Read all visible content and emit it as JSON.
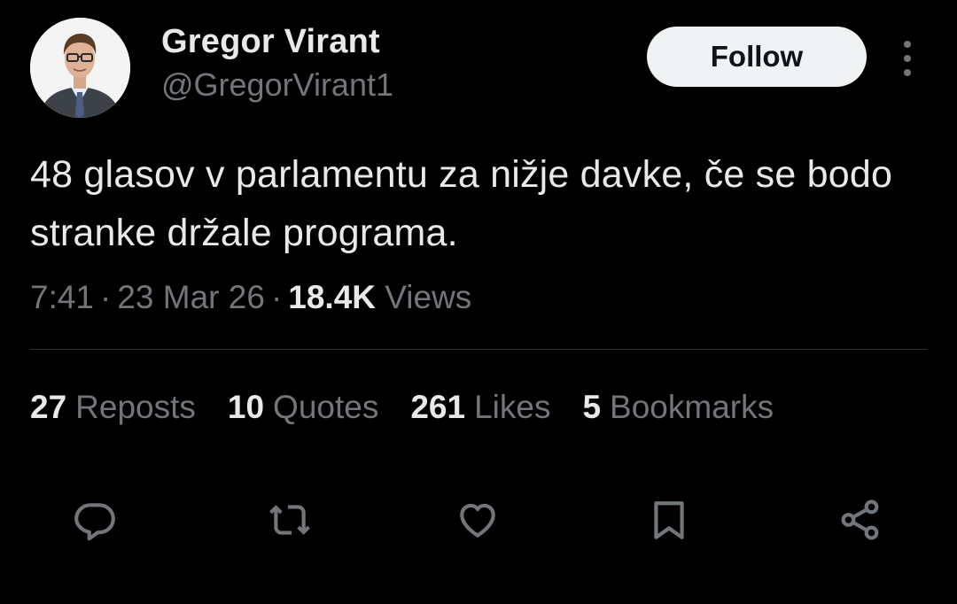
{
  "author": {
    "display_name": "Gregor Virant",
    "handle": "@GregorVirant1"
  },
  "follow_label": "Follow",
  "tweet": {
    "text": "48 glasov v parlamentu za nižje davke, če se bodo stranke držale programa."
  },
  "meta": {
    "time": "7:41",
    "separator": "·",
    "date": "23 Mar 26",
    "views_count": "18.4K",
    "views_label": "Views"
  },
  "stats": {
    "reposts": {
      "count": "27",
      "label": "Reposts"
    },
    "quotes": {
      "count": "10",
      "label": "Quotes"
    },
    "likes": {
      "count": "261",
      "label": "Likes"
    },
    "bookmarks": {
      "count": "5",
      "label": "Bookmarks"
    }
  },
  "actions": {
    "reply_icon": "reply-icon",
    "repost_icon": "repost-icon",
    "like_icon": "heart-icon",
    "bookmark_icon": "bookmark-icon",
    "share_icon": "share-icon"
  },
  "colors": {
    "background": "#000000",
    "primary_text": "#e7e9ea",
    "secondary_text": "#71767b",
    "divider": "#2f3336",
    "follow_button_bg": "#eff3f4",
    "follow_button_text": "#0f1419"
  }
}
